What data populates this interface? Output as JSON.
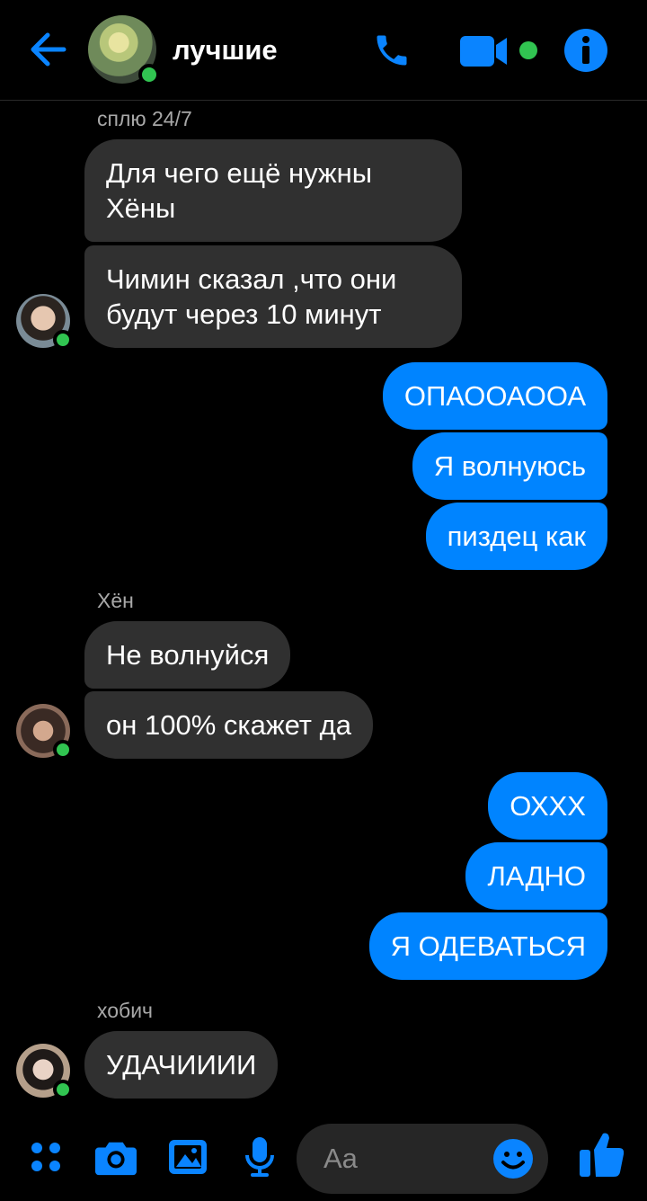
{
  "header": {
    "title": "лучшие",
    "online": true
  },
  "colors": {
    "accent": "#0084ff",
    "incoming": "#303030",
    "online": "#31c451"
  },
  "messages": [
    {
      "sender": "сплю 24/7"
    },
    {
      "text": "Для чего ещё нужны\nХёны"
    },
    {
      "text": "Чимин сказал ,что они\nбудут через 10 минут"
    },
    {
      "text": "ОПАООАООА"
    },
    {
      "text": "Я волнуюсь"
    },
    {
      "text": "пиздец как"
    },
    {
      "sender": "Хён"
    },
    {
      "text": "Не волнуйся"
    },
    {
      "text": "он 100% скажет да"
    },
    {
      "text": "ОХХХ"
    },
    {
      "text": "ЛАДНО"
    },
    {
      "text": "Я ОДЕВАТЬСЯ"
    },
    {
      "sender": "хобич"
    },
    {
      "text": "УДАЧИИИИ"
    }
  ],
  "composer": {
    "placeholder": "Aa"
  },
  "icons": [
    "back-arrow-icon",
    "phone-icon",
    "video-icon",
    "info-icon",
    "menu-dots-icon",
    "camera-icon",
    "gallery-icon",
    "microphone-icon",
    "emoji-icon",
    "thumbs-up-icon"
  ]
}
